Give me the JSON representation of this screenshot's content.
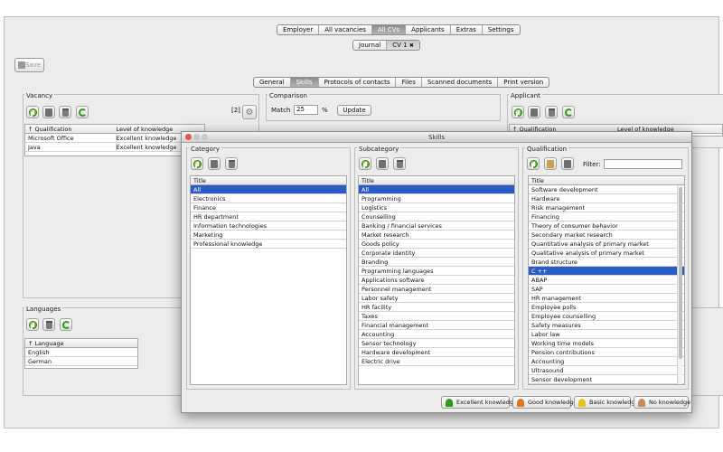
{
  "top_nav": [
    "Employer",
    "All vacancies",
    "All CVs",
    "Applicants",
    "Extras",
    "Settings"
  ],
  "top_nav_active": 2,
  "doc_tabs": {
    "journal": "Journal",
    "cv": "CV 1",
    "close": "✖"
  },
  "toolbar": {
    "save_label": "Save"
  },
  "section_tabs": [
    "General",
    "Skills",
    "Protocols of contacts",
    "Files",
    "Scanned documents",
    "Print version"
  ],
  "section_tabs_active": 1,
  "vacancy": {
    "title": "Vacancy",
    "count": "[2]",
    "columns": [
      "↑ Qualification",
      "Level of knowledge"
    ],
    "rows": [
      [
        "Microsoft Office",
        "Excellent knowledge"
      ],
      [
        "Java",
        "Excellent knowledge"
      ]
    ]
  },
  "comparison": {
    "title": "Comparison",
    "match_label": "Match",
    "match_value": "25",
    "percent": "%",
    "update_label": "Update"
  },
  "applicant": {
    "title": "Applicant",
    "columns": [
      "↑ Qualification",
      "Level of knowledge"
    ]
  },
  "languages": {
    "title": "Languages",
    "column": "↑ Language",
    "rows": [
      "English",
      "German"
    ]
  },
  "dialog": {
    "title": "Skills",
    "category": {
      "title": "Category",
      "column": "Title",
      "rows": [
        "All",
        "Electronics",
        "Finance",
        "HR department",
        "Information technologies",
        "Marketing",
        "Professional knowledge"
      ],
      "selected": 0
    },
    "subcategory": {
      "title": "Subcategory",
      "column": "Title",
      "rows": [
        "All",
        "Programming",
        "Logistics",
        "Counselling",
        "Banking / financial services",
        "Market research",
        "Goods policy",
        "Corporate identity",
        "Branding",
        "Programming languages",
        "Applications software",
        "Personnel management",
        "Labor safety",
        "HR facility",
        "Taxes",
        "Financial management",
        "Accounting",
        "Sensor technology",
        "Hardware development",
        "Electric drive"
      ],
      "selected": 0
    },
    "qualification": {
      "title": "Qualification",
      "filter_label": "Filter:",
      "filter_value": "",
      "column": "Title",
      "rows": [
        "Software development",
        "Hardware",
        "Risk management",
        "Financing",
        "Theory of consumer behavior",
        "Secondary market research",
        "Quantitative analysis of primary market",
        "Qualitative analysis of primary market",
        "Brand structure",
        "C ++",
        "ABAP",
        "SAP",
        "HR management",
        "Employee polls",
        "Employee counselling",
        "Safety measures",
        "Labor law",
        "Working time models",
        "Pension contributions",
        "Accounting",
        "Ultrasound",
        "Sensor development"
      ],
      "selected": 9
    },
    "legend": [
      {
        "label": "Excellent knowledge",
        "color": "#2f9a1a"
      },
      {
        "label": "Good knowledge",
        "color": "#e0761e"
      },
      {
        "label": "Basic knowledge",
        "color": "#e8c21a"
      },
      {
        "label": "No knowledge",
        "color": "#c98a5a"
      }
    ]
  }
}
